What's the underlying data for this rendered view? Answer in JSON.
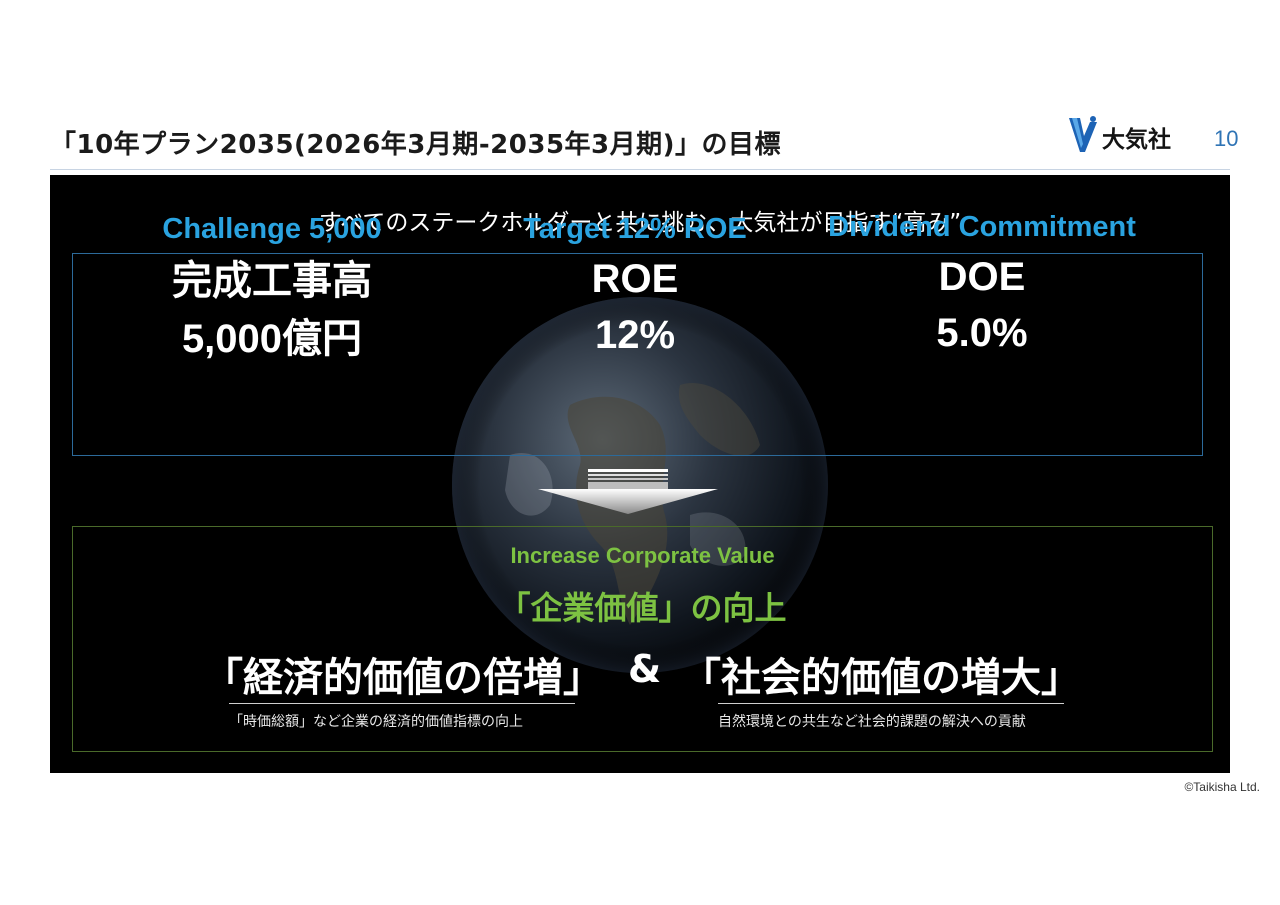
{
  "header": {
    "title": "「10年プラン2035(2026年3月期-2035年3月期)」の目標",
    "logo_text": "大気社",
    "page_number": "10"
  },
  "panel": {
    "tagline": "すべてのステークホルダーと共に挑む、大気社が目指す“高み”",
    "targets": [
      {
        "heading": "Challenge 5,000",
        "line1": "完成工事高",
        "line2": "5,000億円"
      },
      {
        "heading": "Target 12% ROE",
        "line1": "ROE",
        "line2": "12%"
      },
      {
        "heading": "Dividend Commitment",
        "line1": "DOE",
        "line2": "5.0%"
      }
    ],
    "result": {
      "english": "Increase Corporate Value",
      "japanese": "「企業価値」の向上",
      "left_main": "「経済的価値の倍増」",
      "ampersand": "&",
      "right_main": "「社会的価値の増大」",
      "left_sub": "「時価総額」など企業の経済的価値指標の向上",
      "right_sub": "自然環境との共生など社会的課題の解決への貢献"
    }
  },
  "footer": {
    "copyright": "©Taikisha Ltd."
  },
  "colors": {
    "accent_blue": "#2aa3e0",
    "accent_green": "#7dc242",
    "page_number": "#2f74b5",
    "panel_bg": "#000000"
  },
  "icons": [
    "taikisha-logo-mark",
    "down-arrow-icon",
    "earth-image"
  ]
}
